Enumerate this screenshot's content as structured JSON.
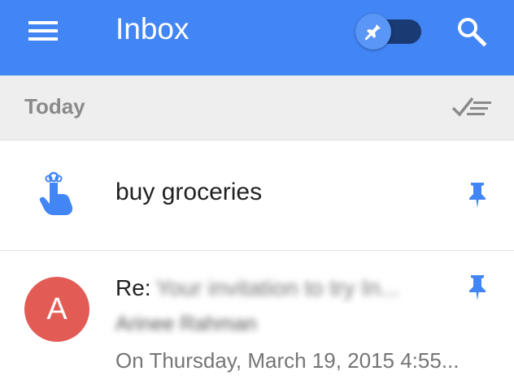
{
  "app": {
    "title": "Inbox"
  },
  "colors": {
    "appbar": "#4285f4",
    "toggle_track": "#1a3a73",
    "toggle_thumb": "#5a96f6",
    "accent_pin": "#4285f4",
    "avatar": "#e25c55",
    "section_bg": "#eeeeee"
  },
  "icons": {
    "menu": "hamburger-menu-icon",
    "pin_toggle": "pin-icon",
    "search": "search-icon",
    "sweep": "sweep-done-icon",
    "reminder": "reminder-finger-icon",
    "pinned": "pinned-icon"
  },
  "section": {
    "title": "Today"
  },
  "items": [
    {
      "type": "reminder",
      "title": "buy groceries",
      "pinned": true
    },
    {
      "type": "email",
      "avatar_letter": "A",
      "subject_prefix": "Re:",
      "subject": "Your invitation to try In...",
      "sender": "Arinee Rahman",
      "snippet": "On Thursday, March 19, 2015 4:55...",
      "pinned": true
    }
  ]
}
